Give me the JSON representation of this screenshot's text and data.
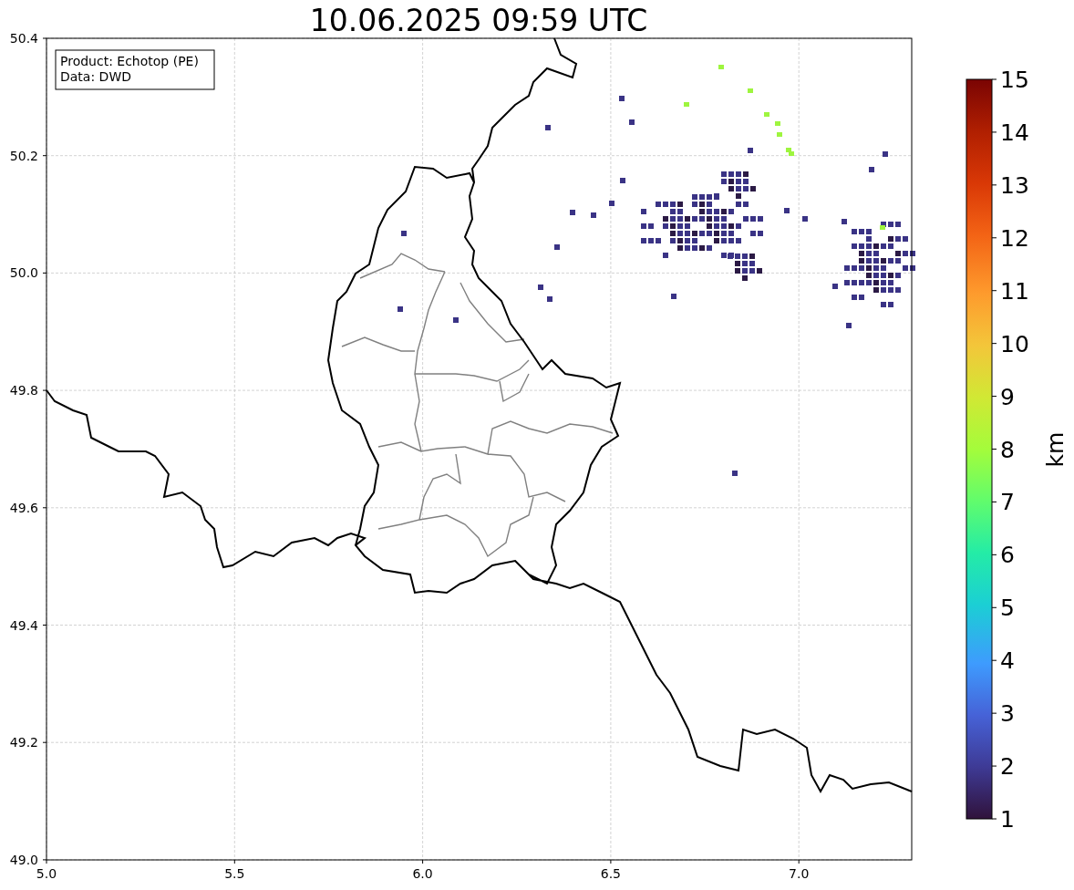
{
  "title": "10.06.2025 09:59 UTC",
  "info_box": [
    "Product: Echotop (PE)",
    "Data: DWD"
  ],
  "x_ticks": [
    "5.0",
    "5.5",
    "6.0",
    "6.5",
    "7.0"
  ],
  "y_ticks": [
    "50.4",
    "50.2",
    "50.0",
    "49.8",
    "49.6",
    "49.4",
    "49.2",
    "49.0"
  ],
  "colorbar": {
    "label": "km",
    "ticks": [
      "15",
      "14",
      "13",
      "12",
      "11",
      "10",
      "9",
      "8",
      "7",
      "6",
      "5",
      "4",
      "3",
      "2",
      "1"
    ]
  }
}
